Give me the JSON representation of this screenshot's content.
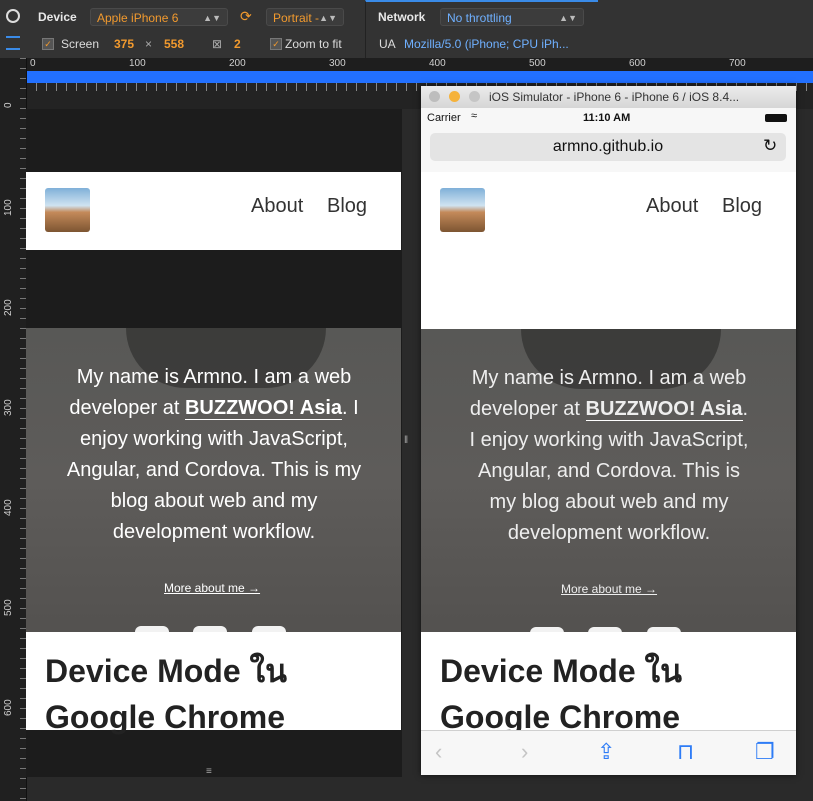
{
  "toolbar": {
    "device_label": "Device",
    "device_value": "Apple iPhone 6",
    "orientation_value": "Portrait -",
    "network_label": "Network",
    "network_value": "No throttling",
    "screen_label": "Screen",
    "screen_width": "375",
    "times": "×",
    "screen_height": "558",
    "dpr": "2",
    "zoom_label": "Zoom to fit",
    "ua_label": "UA",
    "ua_value": "Mozilla/5.0 (iPhone; CPU iPh..."
  },
  "ruler": {
    "h_ticks": [
      "0",
      "100",
      "200",
      "300",
      "400",
      "500",
      "600",
      "700"
    ],
    "v_ticks": [
      "0",
      "100",
      "200",
      "300",
      "400",
      "500",
      "600"
    ]
  },
  "site": {
    "nav": [
      "About",
      "Blog"
    ],
    "hero_text_1": "My name is Armno. I am a web developer at",
    "hero_company": "BUZZWOO! Asia",
    "hero_text_2": ". I enjoy working with JavaScript, Angular, and Cordova. This is my blog about web and my development workflow.",
    "more_link": "More about me →",
    "post_title": "Device Mode ใน Google Chrome"
  },
  "simulator": {
    "title": "iOS Simulator - iPhone 6 - iPhone 6 / iOS 8.4...",
    "carrier": "Carrier",
    "time": "11:10 AM",
    "url": "armno.github.io"
  },
  "icons": [
    "github-icon",
    "twitter-icon",
    "instagram-icon"
  ]
}
